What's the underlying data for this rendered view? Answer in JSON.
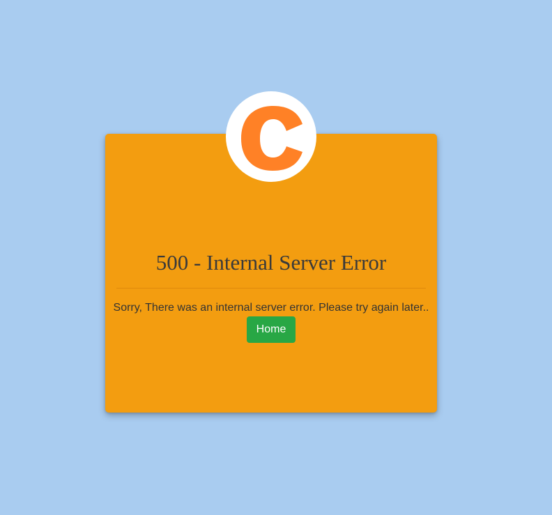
{
  "logo": {
    "letter": "C",
    "icon": "c-logo-icon",
    "color": "#ff8126",
    "background": "#ffffff"
  },
  "error": {
    "title": "500 - Internal Server Error",
    "message": "Sorry, There was an internal server error. Please try again later.."
  },
  "actions": {
    "home_label": "Home"
  },
  "colors": {
    "page_background": "#a9ccf0",
    "card_background": "#f39d10",
    "button_background": "#28a745",
    "button_text": "#ffffff",
    "text": "#333333"
  }
}
